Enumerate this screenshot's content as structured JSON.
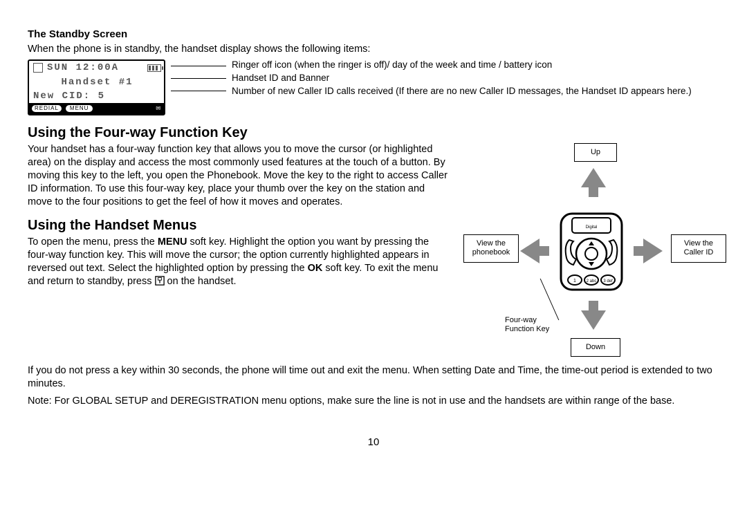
{
  "standby": {
    "title": "The Standby Screen",
    "intro": "When the phone is in standby, the handset display shows the following items:",
    "lcd": {
      "line1_day": "SUN",
      "line1_time": "12:00A",
      "line2": "Handset #1",
      "line3": "New CID:  5",
      "redial": "REDIAL",
      "menu": "MENU"
    },
    "desc1": "Ringer off icon (when the ringer is off)/ day of the week and time / battery icon",
    "desc2": "Handset ID and Banner",
    "desc3": "Number of new Caller ID calls received (If there are no new Caller ID messages, the Handset ID appears here.)"
  },
  "fourway": {
    "title": "Using the Four-way Function Key",
    "body": "Your handset has a four-way function key that allows you to move the cursor (or highlighted area) on the display and access the most commonly used features at the touch of a button. By moving this key to the left, you open the Phonebook. Move the key to the right to access Caller ID information. To use this four-way key, place your thumb over the key on the station and move to the four positions to get the feel of how it moves and operates.",
    "up": "Up",
    "down": "Down",
    "left": "View the\nphonebook",
    "right": "View the\nCaller ID",
    "fnkey": "Four-way\nFunction Key"
  },
  "menus": {
    "title": "Using the Handset Menus",
    "p1a": "To open the menu, press the ",
    "p1_menu": "MENU",
    "p1b": " soft key. Highlight the option you want by pressing the four-way function key. This will move the cursor; the option currently highlighted appears in reversed out text. Select the highlighted option by pressing the ",
    "p1_ok": "OK",
    "p1c": " soft key. To exit the menu and return to standby, press ",
    "p1d": " on the handset.",
    "p2": "If you do not press a key within 30 seconds, the phone will time out and exit the menu. When setting Date and Time, the time-out period is extended to two minutes.",
    "p3": "Note: For GLOBAL SETUP and DEREGISTRATION menu options, make sure the line is not in use and the handsets are within range of the base."
  },
  "page_number": "10"
}
